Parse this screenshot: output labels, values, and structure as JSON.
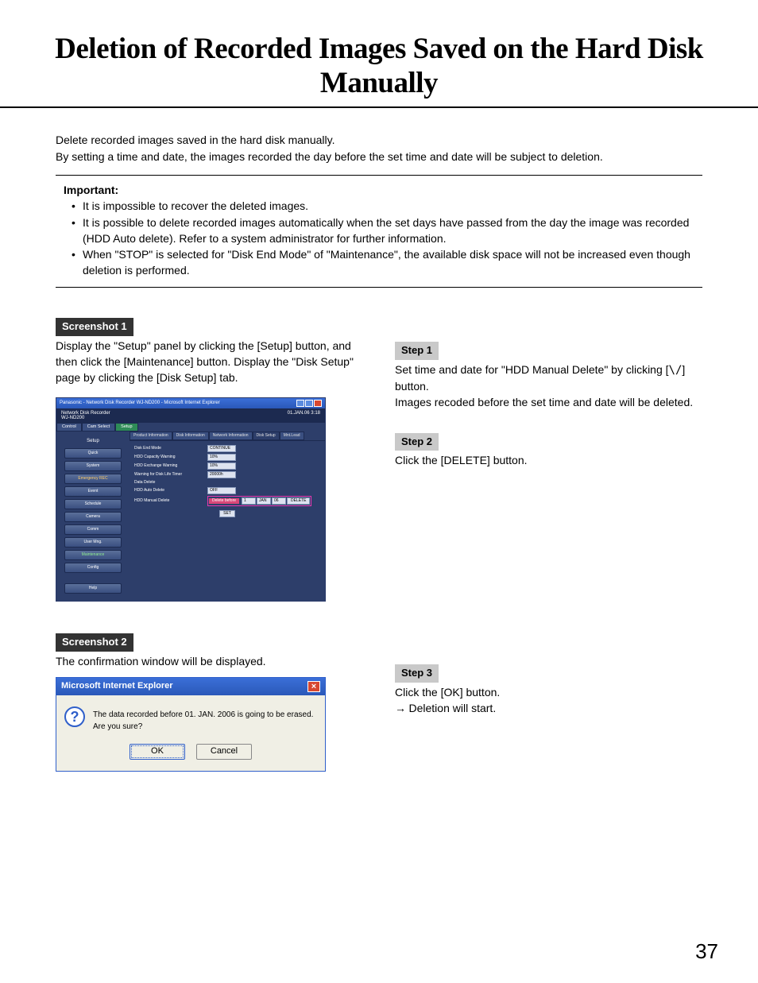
{
  "title": "Deletion of Recorded Images Saved on the Hard Disk Manually",
  "intro1": "Delete recorded images saved in the hard disk manually.",
  "intro2": "By setting a time and date, the images recorded the day before the set time and date will be subject to deletion.",
  "important": {
    "label": "Important:",
    "items": [
      "It is impossible to recover the deleted images.",
      "It is possible to delete recorded images automatically when the set days have passed from the day the image was recorded (HDD Auto delete). Refer to a system administrator for further information.",
      "When \"STOP\" is selected for \"Disk End Mode\" of \"Maintenance\", the available disk space will not be increased even though deletion is performed."
    ]
  },
  "screenshot1": {
    "tag": "Screenshot 1",
    "desc": "Display the \"Setup\" panel by clicking the [Setup] button, and then click the [Maintenance] button. Display the \"Disk Setup\" page by clicking the [Disk Setup] tab.",
    "app": {
      "titlebar": "Panasonic - Network Disk Recorder WJ-ND200 - Microsoft Internet Explorer",
      "model_line1": "Network Disk Recorder",
      "model_line2": "WJ-ND200",
      "datetime": "01.JAN.06   3:18",
      "topnav": [
        "Control",
        "Cam Select",
        "Setup"
      ],
      "setup_label": "Setup",
      "sidebar": [
        "Quick",
        "System",
        "Emergency REC",
        "Event",
        "Schedule",
        "Camera",
        "Comm",
        "User Mng.",
        "Maintenance",
        "Config",
        "Help"
      ],
      "right_tabs": [
        "Product Information",
        "Disk Information",
        "Network Information",
        "Disk Setup",
        "Mnt.Lead"
      ],
      "rows": {
        "disk_end_mode": {
          "label": "Disk End Mode",
          "value": "CONTINUE"
        },
        "capacity_warn": {
          "label": "HDD Capacity Warning",
          "value": "10%"
        },
        "exchange_warn": {
          "label": "HDD Exchange Warning",
          "value": "10%"
        },
        "life_timer": {
          "label": "Warning for Disk Life Timer",
          "value": "20000h"
        },
        "data_delete": {
          "label": "Data Delete"
        },
        "auto_delete": {
          "label": "HDD Auto Delete",
          "value": "OFF"
        },
        "manual_delete": {
          "label": "HDD Manual Delete",
          "prefix": "Delete before",
          "d": "1",
          "m": "JAN",
          "y": "06",
          "btn": "DELETE"
        },
        "set_btn": "SET"
      }
    }
  },
  "screenshot2": {
    "tag": "Screenshot 2",
    "desc": "The confirmation window will be displayed.",
    "dlg": {
      "title": "Microsoft Internet Explorer",
      "message": "The data recorded before 01. JAN. 2006 is going to be erased. Are you sure?",
      "ok": "OK",
      "cancel": "Cancel"
    }
  },
  "step1": {
    "tag": "Step 1",
    "l1": "Set time and date for \"HDD Manual Delete\" by clicking [",
    "l2": "] button.",
    "l3": "Images recoded before the set time and date will be deleted."
  },
  "step2": {
    "tag": "Step 2",
    "text": "Click the [DELETE] button."
  },
  "step3": {
    "tag": "Step 3",
    "l1": "Click the [OK] button.",
    "l2": "Deletion will start."
  },
  "page_number": "37"
}
